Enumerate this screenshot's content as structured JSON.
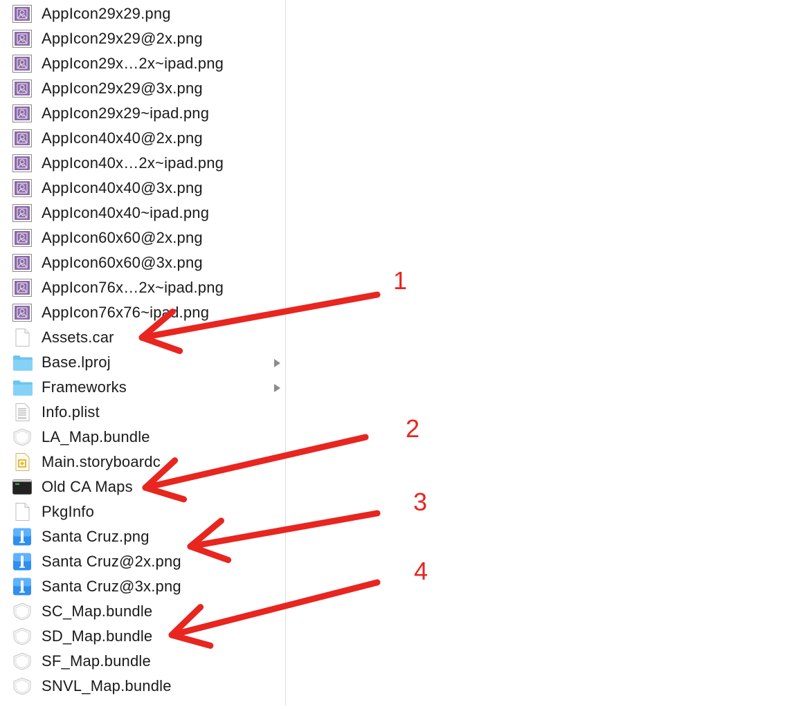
{
  "files": [
    {
      "name": "AppIcon29x29.png",
      "icon": "image-icon"
    },
    {
      "name": "AppIcon29x29@2x.png",
      "icon": "image-icon"
    },
    {
      "name": "AppIcon29x…2x~ipad.png",
      "icon": "image-icon"
    },
    {
      "name": "AppIcon29x29@3x.png",
      "icon": "image-icon"
    },
    {
      "name": "AppIcon29x29~ipad.png",
      "icon": "image-icon"
    },
    {
      "name": "AppIcon40x40@2x.png",
      "icon": "image-icon"
    },
    {
      "name": "AppIcon40x…2x~ipad.png",
      "icon": "image-icon"
    },
    {
      "name": "AppIcon40x40@3x.png",
      "icon": "image-icon"
    },
    {
      "name": "AppIcon40x40~ipad.png",
      "icon": "image-icon"
    },
    {
      "name": "AppIcon60x60@2x.png",
      "icon": "image-icon"
    },
    {
      "name": "AppIcon60x60@3x.png",
      "icon": "image-icon"
    },
    {
      "name": "AppIcon76x…2x~ipad.png",
      "icon": "image-icon"
    },
    {
      "name": "AppIcon76x76~ipad.png",
      "icon": "image-icon"
    },
    {
      "name": "Assets.car",
      "icon": "document-icon"
    },
    {
      "name": "Base.lproj",
      "icon": "folder-icon",
      "disclosure": true
    },
    {
      "name": "Frameworks",
      "icon": "folder-icon",
      "disclosure": true
    },
    {
      "name": "Info.plist",
      "icon": "plist-icon"
    },
    {
      "name": "LA_Map.bundle",
      "icon": "bundle-icon"
    },
    {
      "name": "Main.storyboardc",
      "icon": "storyboard-icon"
    },
    {
      "name": "Old CA Maps",
      "icon": "terminal-icon"
    },
    {
      "name": "PkgInfo",
      "icon": "document-icon"
    },
    {
      "name": "Santa Cruz.png",
      "icon": "xcode-image-icon"
    },
    {
      "name": "Santa Cruz@2x.png",
      "icon": "xcode-image-icon"
    },
    {
      "name": "Santa Cruz@3x.png",
      "icon": "xcode-image-icon"
    },
    {
      "name": "SC_Map.bundle",
      "icon": "bundle-icon"
    },
    {
      "name": "SD_Map.bundle",
      "icon": "bundle-icon"
    },
    {
      "name": "SF_Map.bundle",
      "icon": "bundle-icon"
    },
    {
      "name": "SNVL_Map.bundle",
      "icon": "bundle-icon"
    }
  ],
  "annotations": {
    "color": "#e8251f",
    "callouts": [
      {
        "label": "1",
        "target": "Assets.car"
      },
      {
        "label": "2",
        "target": "Old CA Maps"
      },
      {
        "label": "3",
        "target": "Santa Cruz@2x.png"
      },
      {
        "label": "4",
        "target": "SD_Map.bundle"
      }
    ]
  }
}
